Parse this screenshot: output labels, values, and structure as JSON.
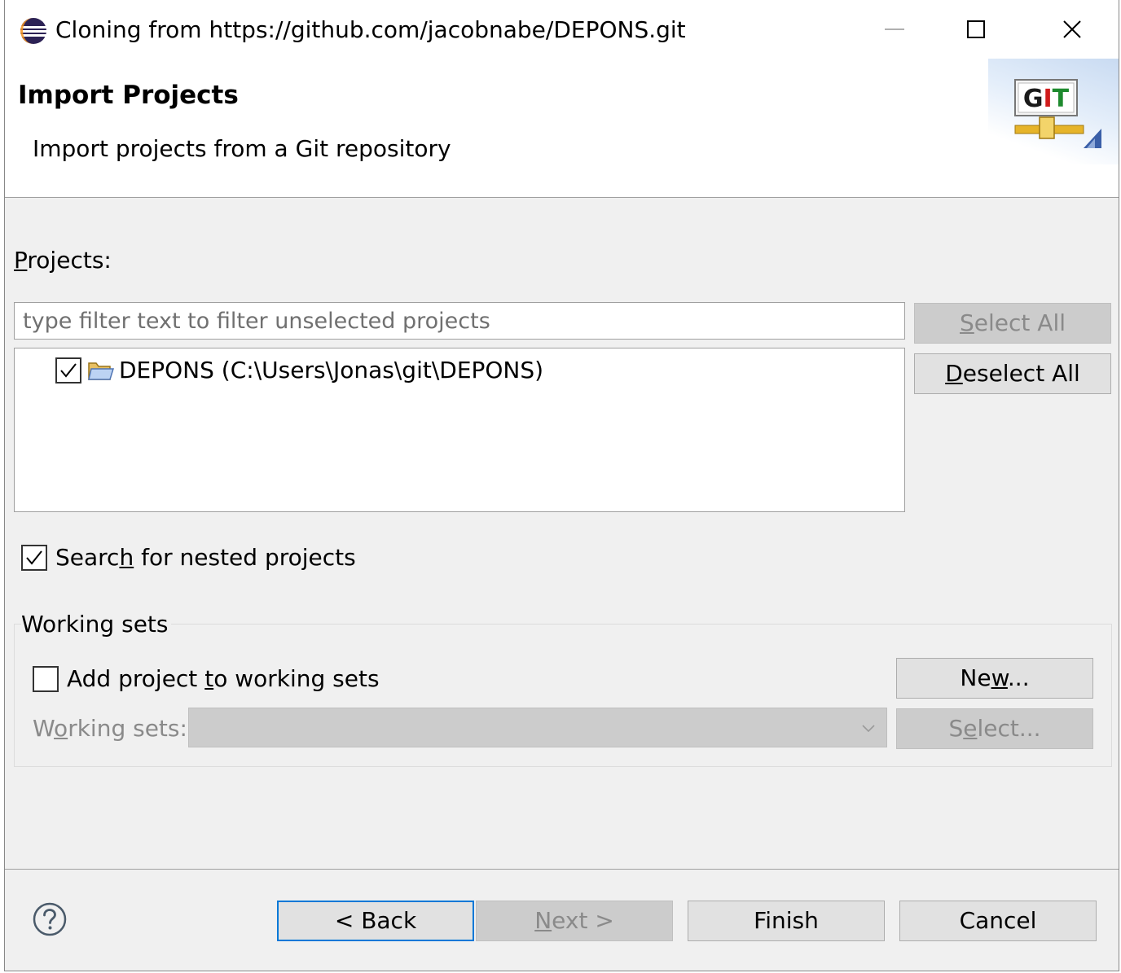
{
  "window": {
    "title": "Cloning from https://github.com/jacobnabe/DEPONS.git"
  },
  "header": {
    "title": "Import Projects",
    "description": "Import projects from a Git repository",
    "logo_text": "GIT"
  },
  "projects": {
    "label_mnemonic": "P",
    "label_rest": "rojects:",
    "filter_placeholder": "type filter text to filter unselected projects",
    "items": [
      {
        "label": "DEPONS (C:\\Users\\Jonas\\git\\DEPONS)",
        "checked": true
      }
    ],
    "select_all": {
      "mnemonic": "S",
      "rest": "elect All",
      "enabled": false
    },
    "deselect_all": {
      "mnemonic": "D",
      "rest": "eselect All",
      "enabled": true
    }
  },
  "nested": {
    "label_pre": "Searc",
    "label_mnemonic": "h",
    "label_post": " for nested projects",
    "checked": true
  },
  "working_sets": {
    "group_title": "Working sets",
    "add_pre": "Add project ",
    "add_mnemonic": "t",
    "add_post": "o working sets",
    "add_checked": false,
    "new_button": {
      "pre": "Ne",
      "mnemonic": "w",
      "post": "...",
      "enabled": true
    },
    "combo_label": {
      "pre": "W",
      "mnemonic": "o",
      "post": "rking sets:"
    },
    "combo_value": "",
    "select_button": {
      "pre": "S",
      "mnemonic": "e",
      "post": "lect...",
      "enabled": false
    }
  },
  "footer": {
    "back": "< Back",
    "next": {
      "mnemonic": "N",
      "rest": "ext >",
      "enabled": false
    },
    "finish": "Finish",
    "cancel": "Cancel"
  }
}
